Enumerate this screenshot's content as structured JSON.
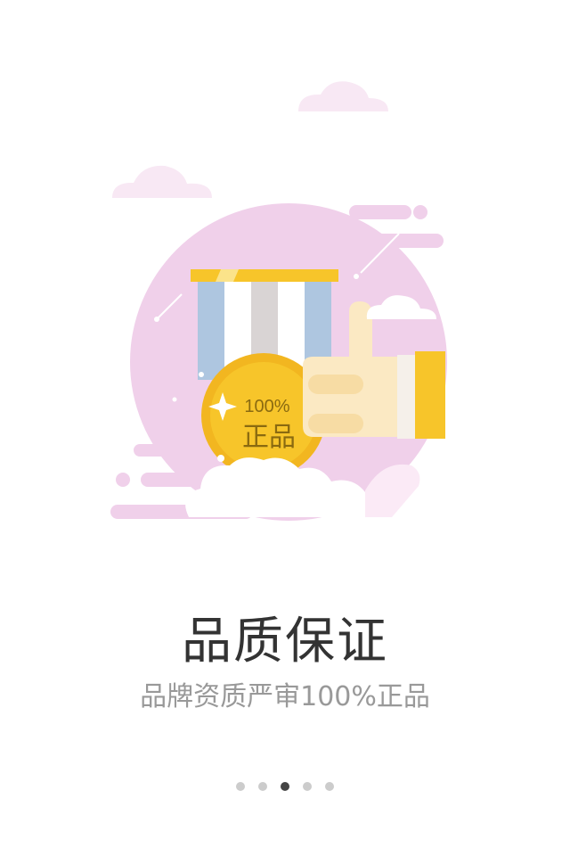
{
  "illustration": {
    "badge_text_1": "100%",
    "badge_text_2": "正品",
    "icon": "medal-thumbs-up-illustration"
  },
  "title": "品质保证",
  "subtitle": "品牌资质严审100%正品",
  "pagination": {
    "total": 5,
    "active_index": 2
  },
  "colors": {
    "background": "#ffffff",
    "circle": "#f0d0ea",
    "gold": "#f7c52a",
    "title": "#333333",
    "subtitle": "#999999",
    "dot": "#cccccc",
    "dot_active": "#444444"
  }
}
